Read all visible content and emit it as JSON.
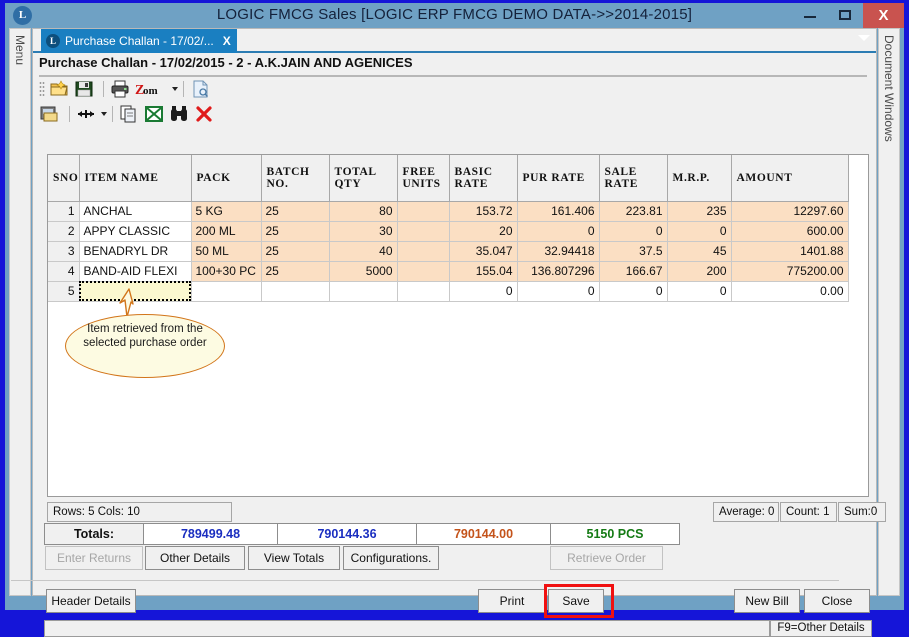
{
  "window": {
    "title": "LOGIC FMCG Sales  [LOGIC ERP FMCG DEMO DATA->>2014-2015]",
    "logo": "L",
    "minimize_label": "–",
    "maximize_label": "□",
    "close_label": "X",
    "titlebar_color": "#6fa1c4",
    "close_color": "#c9534f",
    "frame_color": "#1515d8"
  },
  "side_panels": {
    "left_label": "Menu",
    "right_label": "Document Windows"
  },
  "tab": {
    "icon": "L",
    "label": "Purchase Challan - 17/02/...",
    "close_label": "X",
    "overflow_icon": "chevron-down-icon",
    "active_color": "#1a7fc1"
  },
  "document": {
    "heading": "Purchase Challan - 17/02/2015 - 2 - A.K.JAIN AND AGENICES"
  },
  "toolbar_top": {
    "items": [
      {
        "name": "new-document-icon",
        "title": "New"
      },
      {
        "name": "save-icon",
        "title": "Save"
      },
      {
        "name": "print-icon",
        "title": "Print"
      },
      {
        "name": "zoom-icon",
        "title": "Zoom",
        "label": "Zoom"
      },
      {
        "name": "page-setup-icon",
        "title": "Page"
      }
    ]
  },
  "toolbar_second": {
    "items": [
      {
        "name": "note-card-icon",
        "title": "Notes"
      },
      {
        "name": "resize-columns-icon",
        "title": "Column Width"
      },
      {
        "name": "copy-icon",
        "title": "Copy"
      },
      {
        "name": "export-excel-icon",
        "title": "Export to Excel"
      },
      {
        "name": "find-binoculars-icon",
        "title": "Find"
      },
      {
        "name": "delete-row-icon",
        "title": "Delete"
      }
    ]
  },
  "grid": {
    "columns": [
      "SNO",
      "ITEM NAME",
      "PACK",
      "BATCH NO.",
      "TOTAL QTY",
      "FREE UNITS",
      "BASIC RATE",
      "PUR RATE",
      "SALE RATE",
      "M.R.P.",
      "AMOUNT"
    ],
    "rows": [
      {
        "sno": "1",
        "item": "ANCHAL",
        "pack": "5 KG",
        "batch": "25",
        "qty": "80",
        "free": "",
        "basic": "153.72",
        "pur": "161.406",
        "sale": "223.81",
        "mrp": "235",
        "amount": "12297.60",
        "filled": true
      },
      {
        "sno": "2",
        "item": "APPY CLASSIC",
        "pack": "200 ML",
        "batch": "25",
        "qty": "30",
        "free": "",
        "basic": "20",
        "pur": "0",
        "sale": "0",
        "mrp": "0",
        "amount": "600.00",
        "filled": true
      },
      {
        "sno": "3",
        "item": "BENADRYL DR",
        "pack": "50 ML",
        "batch": "25",
        "qty": "40",
        "free": "",
        "basic": "35.047",
        "pur": "32.94418",
        "sale": "37.5",
        "mrp": "45",
        "amount": "1401.88",
        "filled": true
      },
      {
        "sno": "4",
        "item": "BAND-AID FLEXI",
        "pack": "100+30 PC",
        "batch": "25",
        "qty": "5000",
        "free": "",
        "basic": "155.04",
        "pur": "136.807296",
        "sale": "166.67",
        "mrp": "200",
        "amount": "775200.00",
        "filled": true
      },
      {
        "sno": "5",
        "item": "",
        "pack": "",
        "batch": "",
        "qty": "",
        "free": "",
        "basic": "0",
        "pur": "0",
        "sale": "0",
        "mrp": "0",
        "amount": "0.00",
        "filled": false,
        "active": true
      }
    ],
    "row_fill_color": "#fbdfc3",
    "active_cell_color": "#fbf8d0"
  },
  "callout": {
    "text": "Item retrieved from the selected purchase order",
    "border_color": "#d2751a",
    "fill_color": "#fdfbe2"
  },
  "grid_status": {
    "rows_cols": "Rows: 5  Cols: 10",
    "average": "Average: 0",
    "count": "Count: 1",
    "sum": "Sum:0"
  },
  "totals": {
    "label": "Totals:",
    "cells": [
      {
        "value": "789499.48",
        "color": "#1a2ec0"
      },
      {
        "value": "790144.36",
        "color": "#1a2ec0"
      },
      {
        "value": "790144.00",
        "color": "#c4531a"
      },
      {
        "value": "5150 PCS",
        "color": "#147a14"
      }
    ]
  },
  "small_buttons": [
    {
      "label": "Enter Returns",
      "enabled": false
    },
    {
      "label": "Other Details",
      "enabled": true
    },
    {
      "label": "View Totals",
      "enabled": true
    },
    {
      "label": "Configurations.",
      "enabled": true
    },
    {
      "label": "Retrieve Order",
      "enabled": false
    }
  ],
  "bottom_buttons": {
    "header_details": "Header Details",
    "print": "Print",
    "save": "Save",
    "new_bill": "New Bill",
    "close": "Close",
    "save_highlight_color": "#f01010"
  },
  "status_bar": {
    "message": "",
    "hint": "F9=Other Details"
  }
}
